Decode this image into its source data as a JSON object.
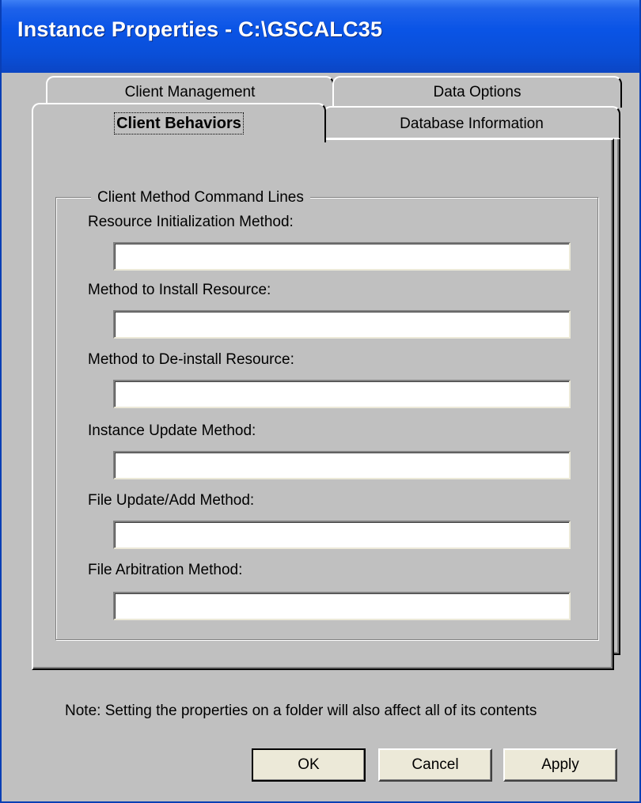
{
  "window": {
    "title": "Instance Properties - C:\\GSCALC35"
  },
  "tabs": {
    "back_row": [
      {
        "label": "Client Management"
      },
      {
        "label": "Data Options"
      }
    ],
    "front_row": [
      {
        "label": "Client Behaviors",
        "active": true
      },
      {
        "label": "Database Information",
        "active": false
      }
    ]
  },
  "group": {
    "legend": "Client Method Command Lines",
    "fields": [
      {
        "label": "Resource Initialization Method:",
        "value": ""
      },
      {
        "label": "Method to Install Resource:",
        "value": ""
      },
      {
        "label": "Method to De-install Resource:",
        "value": ""
      },
      {
        "label": "Instance Update Method:",
        "value": ""
      },
      {
        "label": "File Update/Add Method:",
        "value": ""
      },
      {
        "label": "File Arbitration Method:",
        "value": ""
      }
    ]
  },
  "note": "Note: Setting the properties on a folder will also affect all of its contents",
  "buttons": {
    "ok": "OK",
    "cancel": "Cancel",
    "apply": "Apply"
  },
  "colors": {
    "titlebar": "#0a54e6",
    "face": "#c0c0c0",
    "button_face": "#ece9d8"
  }
}
